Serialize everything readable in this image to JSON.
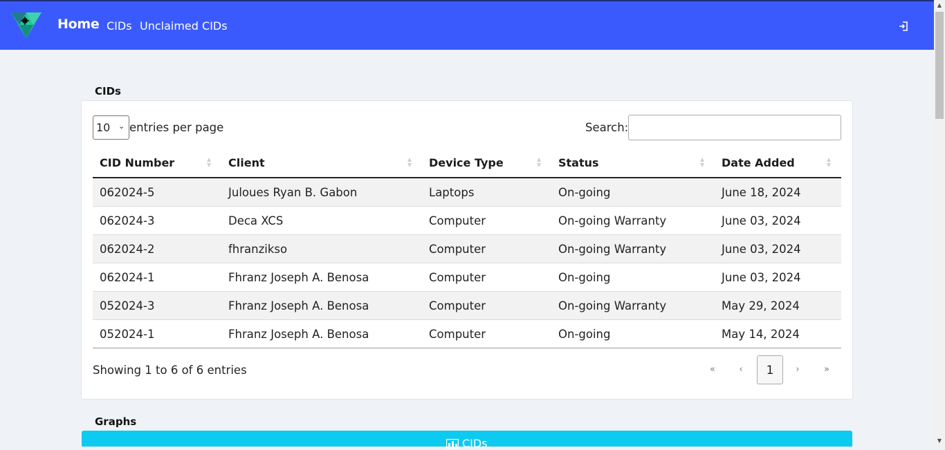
{
  "nav": {
    "home": "Home",
    "links": [
      "CIDs",
      "Unclaimed CIDs"
    ],
    "logout_icon": "logout-icon",
    "accent": "#3b5afe"
  },
  "cids_section": {
    "title": "CIDs",
    "per_page_value": "10",
    "per_page_label": "entries per page",
    "search_label": "Search:",
    "search_value": "",
    "columns": [
      "CID Number",
      "Client",
      "Device Type",
      "Status",
      "Date Added"
    ],
    "rows": [
      [
        "062024-5",
        "Juloues Ryan B. Gabon",
        "Laptops",
        "On-going",
        "June 18, 2024"
      ],
      [
        "062024-3",
        "Deca XCS",
        "Computer",
        "On-going Warranty",
        "June 03, 2024"
      ],
      [
        "062024-2",
        "fhranzikso",
        "Computer",
        "On-going Warranty",
        "June 03, 2024"
      ],
      [
        "062024-1",
        "Fhranz Joseph A. Benosa",
        "Computer",
        "On-going",
        "June 03, 2024"
      ],
      [
        "052024-3",
        "Fhranz Joseph A. Benosa",
        "Computer",
        "On-going Warranty",
        "May 29, 2024"
      ],
      [
        "052024-1",
        "Fhranz Joseph A. Benosa",
        "Computer",
        "On-going",
        "May 14, 2024"
      ]
    ],
    "info": "Showing 1 to 6 of 6 entries",
    "pagination": {
      "first": "«",
      "prev": "‹",
      "current": "1",
      "next": "›",
      "last": "»"
    }
  },
  "graphs_section": {
    "title": "Graphs",
    "bar_label": "CIDs",
    "bar_icon": "chart-icon",
    "bar_color": "#0dcaf0"
  }
}
